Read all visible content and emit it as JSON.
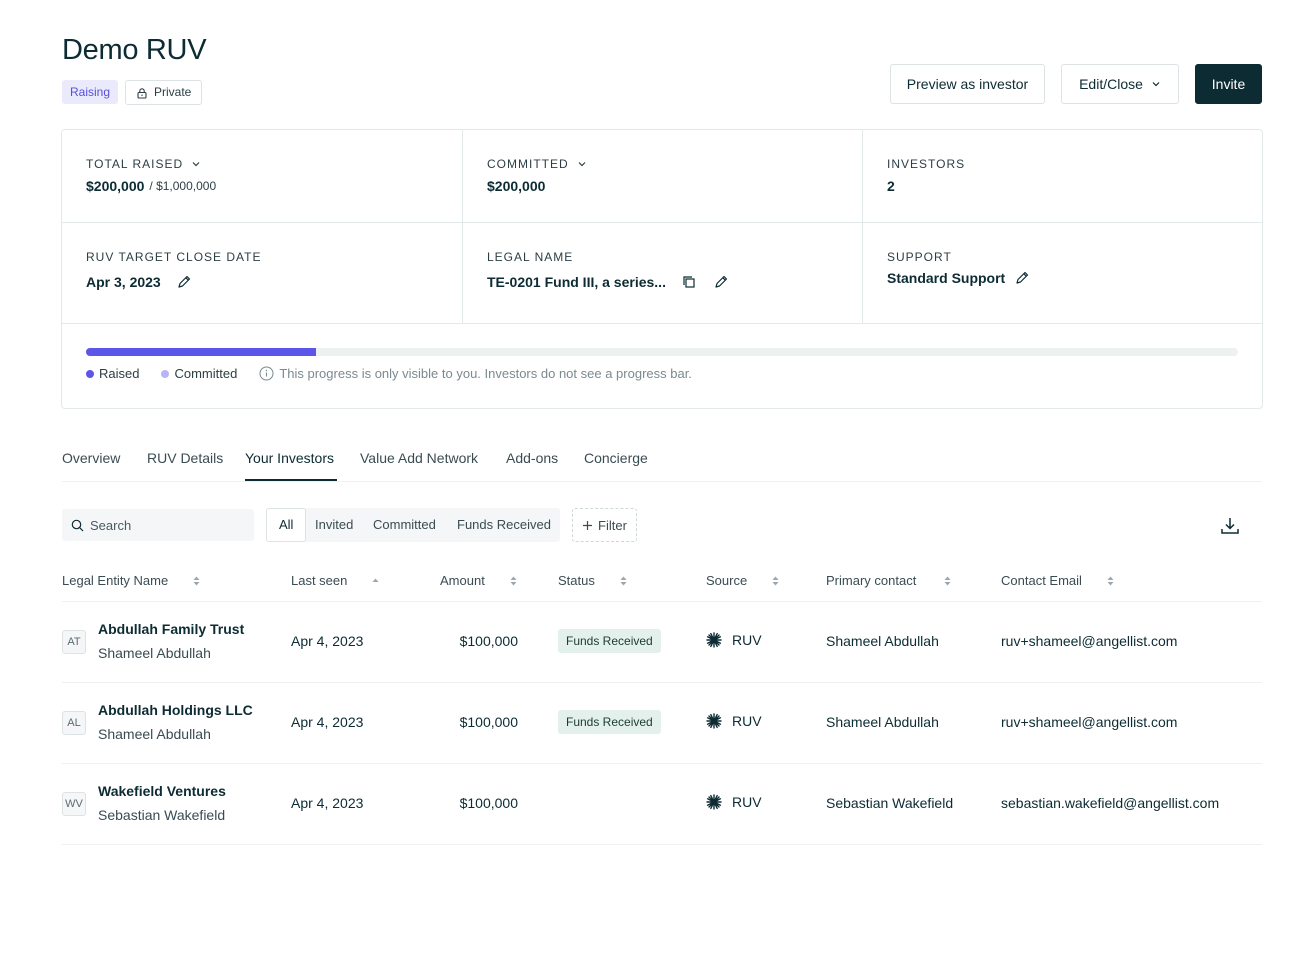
{
  "header": {
    "title": "Demo RUV",
    "status_badge": "Raising",
    "privacy_badge": "Private",
    "preview_button": "Preview as investor",
    "edit_button": "Edit/Close",
    "invite_button": "Invite"
  },
  "stats": {
    "total_raised": {
      "label": "TOTAL RAISED",
      "value": "$200,000",
      "target": "/ $1,000,000"
    },
    "committed": {
      "label": "COMMITTED",
      "value": "$200,000"
    },
    "investors": {
      "label": "INVESTORS",
      "value": "2"
    },
    "close_date": {
      "label": "RUV TARGET CLOSE DATE",
      "value": "Apr 3, 2023"
    },
    "legal_name": {
      "label": "LEGAL NAME",
      "value": "TE-0201 Fund III, a series..."
    },
    "support": {
      "label": "SUPPORT",
      "value": "Standard Support"
    }
  },
  "progress": {
    "raised_fraction": 0.2,
    "legend_raised": "Raised",
    "legend_committed": "Committed",
    "note": "This progress is only visible to you. Investors do not see a progress bar.",
    "raised_color": "#5b55e8",
    "committed_color": "#b8b5f5"
  },
  "tabs": [
    "Overview",
    "RUV Details",
    "Your Investors",
    "Value Add Network",
    "Add-ons",
    "Concierge"
  ],
  "active_tab": "Your Investors",
  "toolbar": {
    "search_placeholder": "Search",
    "filters": [
      "All",
      "Invited",
      "Committed",
      "Funds Received"
    ],
    "filter_button": "Filter"
  },
  "table": {
    "columns": [
      "Legal Entity Name",
      "Last seen",
      "Amount",
      "Status",
      "Source",
      "Primary contact",
      "Contact Email"
    ],
    "rows": [
      {
        "initials": "AT",
        "entity": "Abdullah Family Trust",
        "person": "Shameel Abdullah",
        "last_seen": "Apr 4, 2023",
        "amount": "$100,000",
        "status": "Funds Received",
        "source": "RUV",
        "primary_contact": "Shameel Abdullah",
        "email": "ruv+shameel@angellist.com"
      },
      {
        "initials": "AL",
        "entity": "Abdullah Holdings LLC",
        "person": "Shameel Abdullah",
        "last_seen": "Apr 4, 2023",
        "amount": "$100,000",
        "status": "Funds Received",
        "source": "RUV",
        "primary_contact": "Shameel Abdullah",
        "email": "ruv+shameel@angellist.com"
      },
      {
        "initials": "WV",
        "entity": "Wakefield Ventures",
        "person": "Sebastian Wakefield",
        "last_seen": "Apr 4, 2023",
        "amount": "$100,000",
        "status": "",
        "source": "RUV",
        "primary_contact": "Sebastian Wakefield",
        "email": "sebastian.wakefield@angellist.com"
      }
    ]
  }
}
